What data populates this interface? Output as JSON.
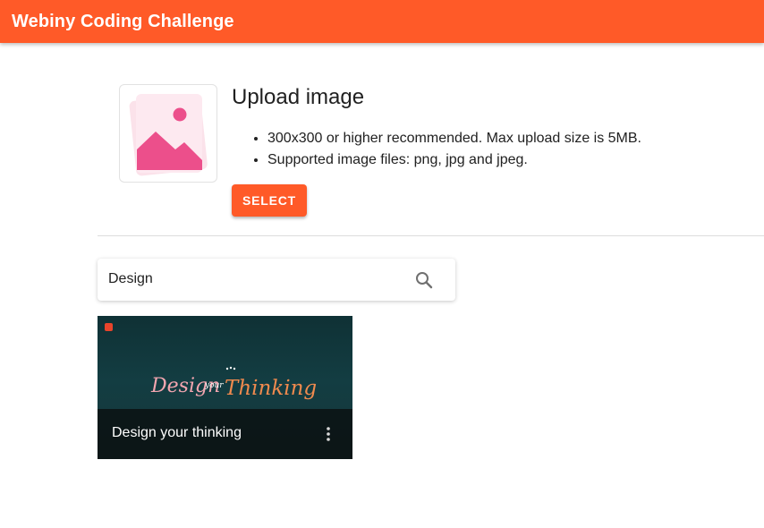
{
  "app": {
    "title": "Webiny Coding Challenge"
  },
  "upload": {
    "title": "Upload image",
    "bullets": [
      "300x300 or higher recommended. Max upload size is 5MB.",
      "Supported image files: png, jpg and jpeg."
    ],
    "select_label": "SELECT"
  },
  "search": {
    "value": "Design",
    "placeholder": ""
  },
  "results": [
    {
      "title": "Design your thinking",
      "art_text_1": "Design",
      "art_text_2": "your",
      "art_text_3": "Thinking"
    }
  ],
  "colors": {
    "accent": "#ff5a28",
    "placeholder_pink": "#ec4f8b",
    "card_bg": "#133d42"
  },
  "icons": {
    "search": "search-icon",
    "more": "more-vert-icon",
    "image": "image-placeholder-icon"
  }
}
